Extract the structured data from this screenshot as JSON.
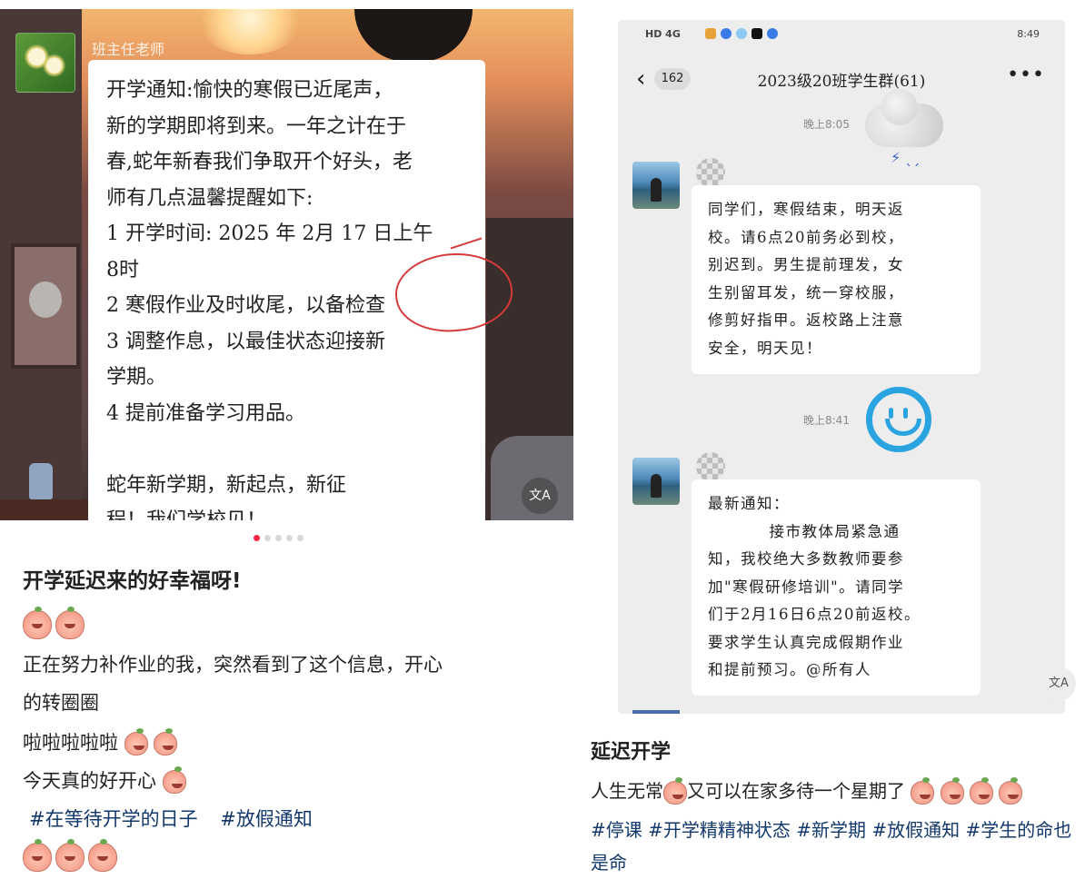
{
  "left": {
    "sender_name": "班主任老师",
    "notice_text": "开学通知:愉快的寒假已近尾声，\n新的学期即将到来。一年之计在于\n春,蛇年新春我们争取开个好头，老\n师有几点温馨提醒如下:\n1 开学时间: 2025 年 2月 17 日上午\n8时\n2 寒假作业及时收尾，以备检查\n3 调整作息，以最佳状态迎接新\n学期。\n4 提前准备学习用品。\n\n蛇年新学期，新起点，新征\n程！我们学校见！",
    "translate_label": "文A",
    "carousel_count": 5,
    "carousel_active": 0,
    "title": "开学延迟来的好幸福呀!",
    "line1": "正在努力补作业的我，突然看到了这个信息，开心",
    "line2": "的转圈圈",
    "line3": "啦啦啦啦啦",
    "line4": "今天真的好开心",
    "tag1": "#在等待开学的日子",
    "tag2": "#放假通知"
  },
  "right": {
    "status_left": "HD 4G",
    "status_time": "8:49",
    "unread_count": "162",
    "chat_title": "2023级20班学生群(61)",
    "time1": "晚上8:05",
    "msg1": "同学们，寒假结束，明天返\n校。请6点20前务必到校，\n别迟到。男生提前理发，女\n生别留耳发，统一穿校服，\n修剪好指甲。返校路上注意\n安全，明天见！",
    "time2": "晚上8:41",
    "msg2": "最新通知：\n          接市教体局紧急通\n知，我校绝大多数教师要参\n加\"寒假研修培训\"。请同学\n们于2月16日6点20前返校。\n要求学生认真完成假期作业\n和提前预习。@所有人",
    "translate_label": "文A",
    "title": "延迟开学",
    "body": "人生无常",
    "body2": "又可以在家多待一个星期了",
    "tags": "#停课   #开学精精神状态   #新学期   #放假通知   #学生的命也是命"
  },
  "colors": {
    "accent_red": "#ff2442",
    "tag_blue": "#13386c",
    "smile_blue": "#2aa4e0"
  }
}
